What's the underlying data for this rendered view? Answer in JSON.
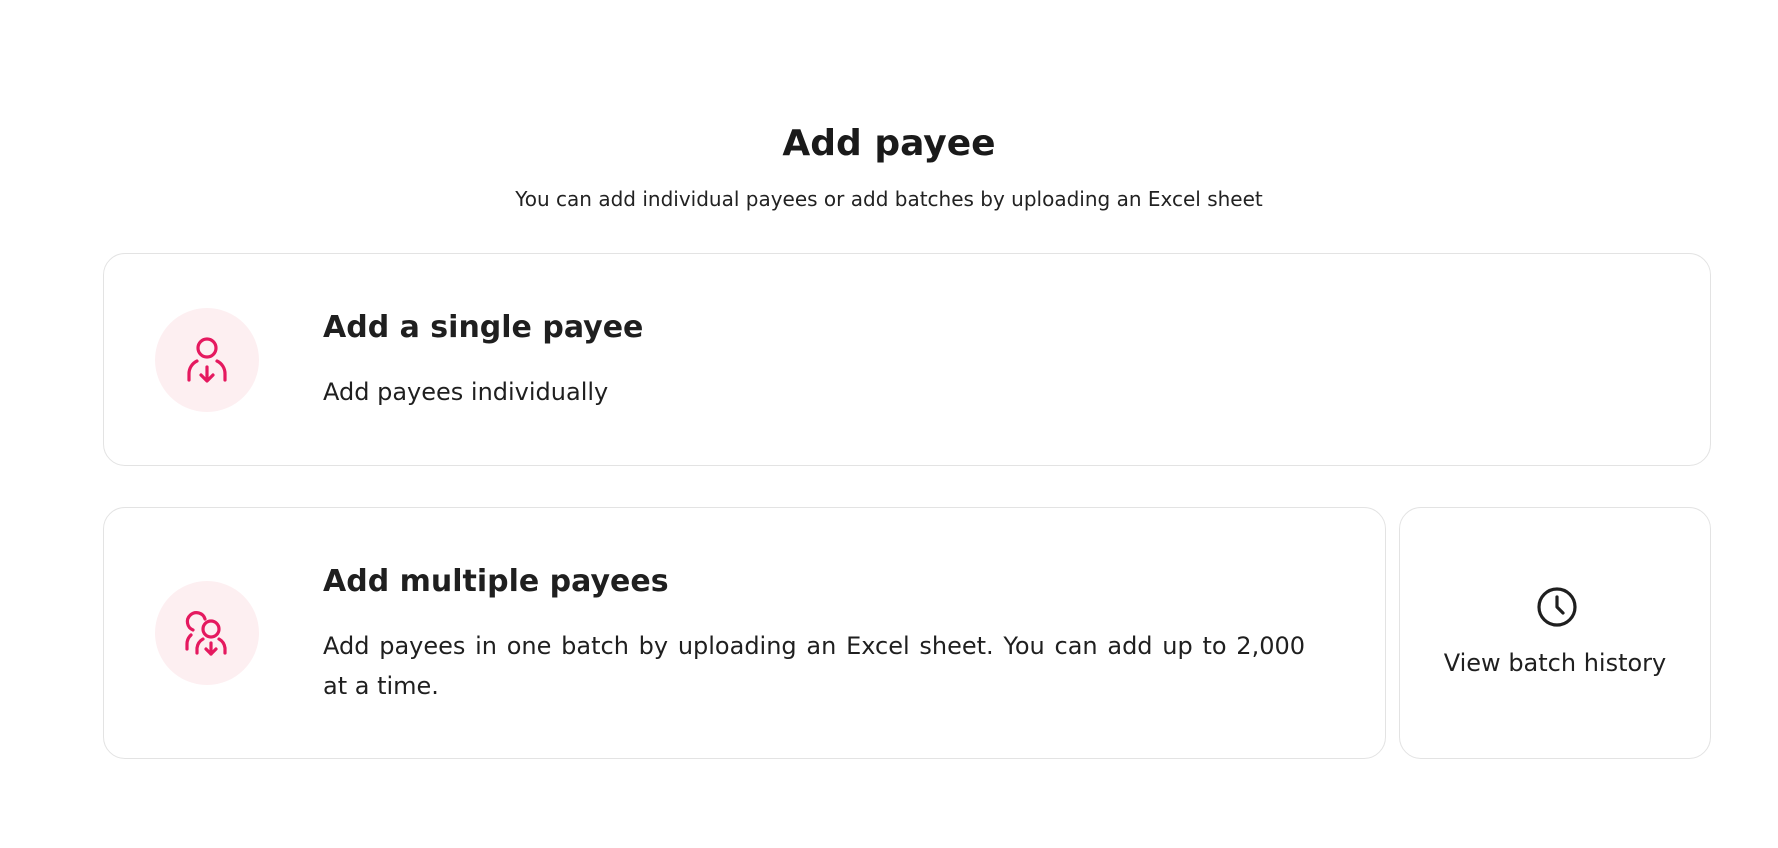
{
  "header": {
    "title": "Add payee",
    "subtitle": "You can add individual payees or add batches by uploading an Excel sheet"
  },
  "single_card": {
    "icon": "user-download-icon",
    "title": "Add a single payee",
    "description": "Add payees individually"
  },
  "multi_card": {
    "icon": "users-download-icon",
    "title": "Add multiple payees",
    "description": "Add payees in one batch by uploading an Excel sheet. You can add up to 2,000 at a time."
  },
  "history_card": {
    "icon": "clock-icon",
    "label": "View batch history"
  },
  "colors": {
    "accent": "#e5195f",
    "icon_bg": "#fdeff1",
    "border": "#e3e3e3",
    "text": "#1f1f1f"
  }
}
